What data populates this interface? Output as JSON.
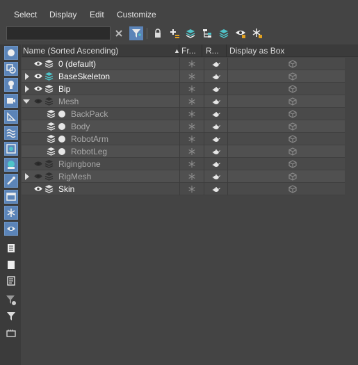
{
  "menu": {
    "items": [
      "Select",
      "Display",
      "Edit",
      "Customize"
    ]
  },
  "toolbar": {
    "search_value": "",
    "icons": [
      "clear-search-icon",
      "filter-toggle-icon",
      "lock-icon",
      "add-to-layer-icon",
      "create-layer-icon",
      "hierarchy-icon",
      "layer-stack-icon",
      "hide-icon",
      "freeze-icon"
    ]
  },
  "columns": {
    "name": "Name (Sorted Ascending)",
    "frozen": "Fr...",
    "render": "R...",
    "display_box": "Display as Box"
  },
  "rows": [
    {
      "label": "0 (default)",
      "indent": 0,
      "expander": "none",
      "visible": true,
      "icon": "layer",
      "active_layer": false,
      "dim": false
    },
    {
      "label": "BaseSkeleton",
      "indent": 0,
      "expander": "collapsed",
      "visible": true,
      "icon": "layer",
      "active_layer": true,
      "dim": false
    },
    {
      "label": "Bip",
      "indent": 0,
      "expander": "collapsed",
      "visible": true,
      "icon": "layer",
      "active_layer": false,
      "dim": false
    },
    {
      "label": "Mesh",
      "indent": 0,
      "expander": "expanded",
      "visible": false,
      "icon": "layer",
      "active_layer": false,
      "dim": true
    },
    {
      "label": "BackPack",
      "indent": 1,
      "expander": "none",
      "visible": false,
      "icon": "object",
      "active_layer": false,
      "dim": true
    },
    {
      "label": "Body",
      "indent": 1,
      "expander": "none",
      "visible": false,
      "icon": "object",
      "active_layer": false,
      "dim": true
    },
    {
      "label": "RobotArm",
      "indent": 1,
      "expander": "none",
      "visible": false,
      "icon": "object",
      "active_layer": false,
      "dim": true
    },
    {
      "label": "RobotLeg",
      "indent": 1,
      "expander": "none",
      "visible": false,
      "icon": "object",
      "active_layer": false,
      "dim": true
    },
    {
      "label": "Rigingbone",
      "indent": 0,
      "expander": "none",
      "visible": false,
      "icon": "layer",
      "active_layer": false,
      "dim": true
    },
    {
      "label": "RigMesh",
      "indent": 0,
      "expander": "collapsed",
      "visible": false,
      "icon": "layer",
      "active_layer": false,
      "dim": true
    },
    {
      "label": "Skin",
      "indent": 0,
      "expander": "none",
      "visible": true,
      "icon": "layer",
      "active_layer": false,
      "dim": false
    }
  ],
  "sidebar": {
    "icons": [
      "geometry-filter-icon",
      "shapes-filter-icon",
      "lights-filter-icon",
      "cameras-filter-icon",
      "helpers-filter-icon",
      "spacewarps-filter-icon",
      "groups-filter-icon",
      "xrefs-filter-icon",
      "bones-filter-icon",
      "containers-filter-icon",
      "frozen-filter-icon",
      "hidden-filter-icon",
      "select-all-icon",
      "select-none-icon",
      "invert-selection-icon",
      "filter-settings-icon",
      "filter-icon",
      "layers-mode-icon"
    ]
  },
  "colors": {
    "accent": "#5b84b8",
    "active_layer": "#4fc3c8"
  }
}
